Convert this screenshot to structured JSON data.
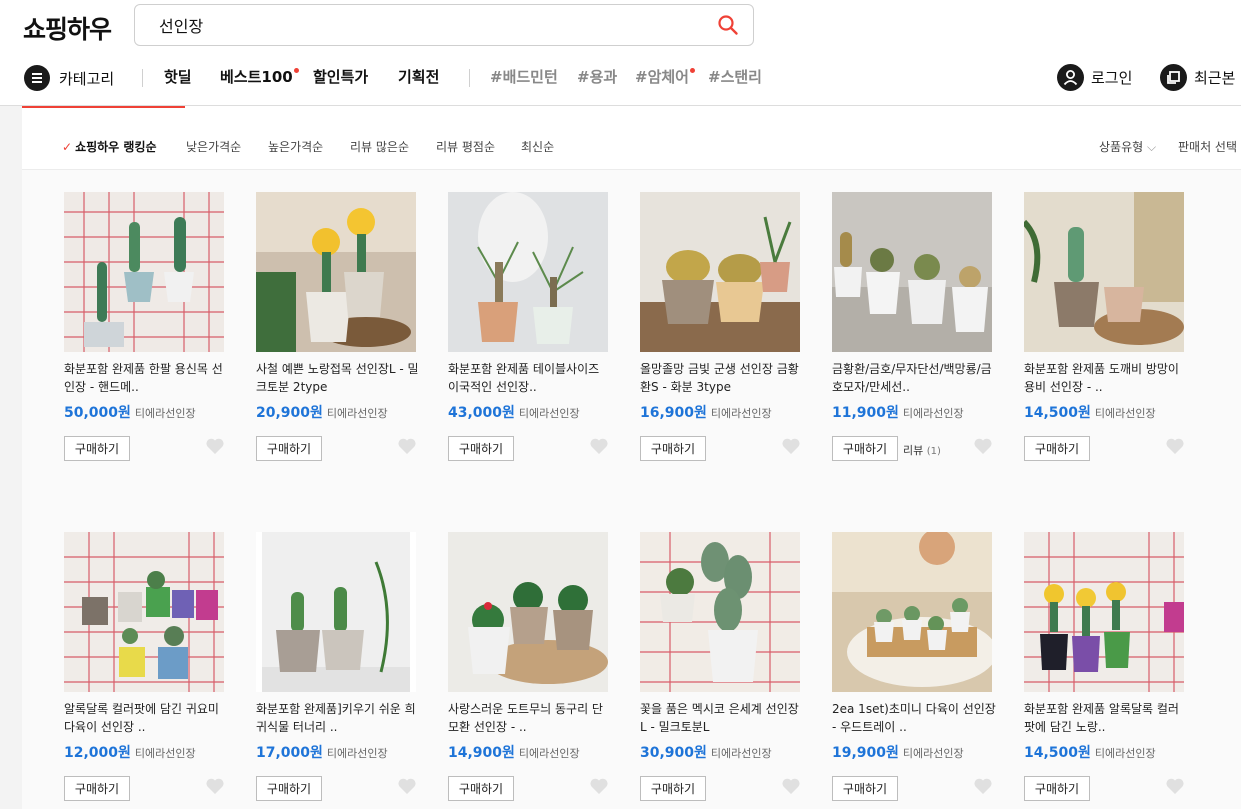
{
  "header": {
    "logo": "쇼핑하우",
    "search_value": "선인장",
    "category_label": "카테고리",
    "nav": [
      "핫딜",
      "베스트100",
      "할인특가",
      "기획전"
    ],
    "tags": [
      "#배드민턴",
      "#용과",
      "#암체어",
      "#스탠리"
    ],
    "login_label": "로그인",
    "recent_label": "최근본"
  },
  "sort": {
    "options": [
      "쇼핑하우 랭킹순",
      "낮은가격순",
      "높은가격순",
      "리뷰 많은순",
      "리뷰 평점순",
      "최신순"
    ],
    "product_type": "상품유형",
    "seller_select": "판매처 선택"
  },
  "buy_label": "구매하기",
  "products": [
    {
      "title": "화분포함 완제품 한팔 용신목 선인장 - 핸드메..",
      "price": "50,000원",
      "seller": "티에라선인장"
    },
    {
      "title": "사철 예쁜 노랑접목 선인장L - 밀크토분 2type",
      "price": "20,900원",
      "seller": "티에라선인장"
    },
    {
      "title": "화분포함 완제품 테이블사이즈 이국적인 선인장..",
      "price": "43,000원",
      "seller": "티에라선인장"
    },
    {
      "title": "올망졸망 금빛 군생 선인장 금황환S - 화분 3type",
      "price": "16,900원",
      "seller": "티에라선인장"
    },
    {
      "title": "금황환/금호/무자단선/백망룡/금호모자/만세선..",
      "price": "11,900원",
      "seller": "티에라선인장",
      "review": "리뷰",
      "review_count": "(1)"
    },
    {
      "title": "화분포함 완제품 도깨비 방망이 용비 선인장 - ..",
      "price": "14,500원",
      "seller": "티에라선인장"
    },
    {
      "title": "알록달록 컬러팟에 담긴 귀요미 다육이 선인장 ..",
      "price": "12,000원",
      "seller": "티에라선인장"
    },
    {
      "title": "화분포함 완제품]키우기 쉬운 희귀식물 터너리 ..",
      "price": "17,000원",
      "seller": "티에라선인장"
    },
    {
      "title": "사랑스러운 도트무늬 동구리 단모환 선인장 - ..",
      "price": "14,900원",
      "seller": "티에라선인장"
    },
    {
      "title": "꽃을 품은 멕시코 은세계 선인장L - 밀크토분L",
      "price": "30,900원",
      "seller": "티에라선인장"
    },
    {
      "title": "2ea 1set)초미니 다육이 선인장 - 우드트레이 ..",
      "price": "19,900원",
      "seller": "티에라선인장"
    },
    {
      "title": "화분포함 완제품 알록달록 컬러팟에 담긴 노랑..",
      "price": "14,500원",
      "seller": "티에라선인장"
    }
  ],
  "colors": {
    "accent": "#ef4136",
    "price": "#1e74d8"
  },
  "icons": [
    "search-icon",
    "menu-icon",
    "user-icon",
    "recent-icon",
    "heart-icon",
    "check-icon",
    "chevron-down-icon"
  ]
}
